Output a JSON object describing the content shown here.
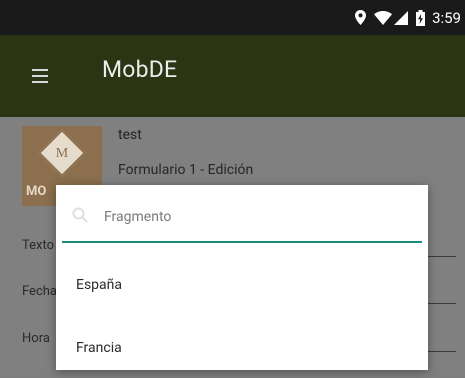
{
  "status_bar": {
    "time": "3:59",
    "icons": [
      "location-icon",
      "wifi-icon",
      "signal-icon",
      "battery-charging-icon"
    ]
  },
  "app_bar": {
    "title": "MobDE",
    "menu_icon": "hamburger-menu-icon"
  },
  "record": {
    "logo_text": "MO",
    "logo_letter": "M",
    "title": "test",
    "subtitle": "Formulario 1 - Edición"
  },
  "fields": [
    {
      "label": "Texto"
    },
    {
      "label": "Fecha"
    },
    {
      "label": "Hora"
    }
  ],
  "dialog": {
    "search_placeholder": "Fragmento",
    "options": [
      "España",
      "Francia"
    ]
  },
  "colors": {
    "status_bar": "#1a1a1a",
    "app_bar": "#2b3413",
    "dim_overlay": "#808080",
    "accent": "#1a8a7a",
    "logo_bg": "#8b6f4e"
  }
}
